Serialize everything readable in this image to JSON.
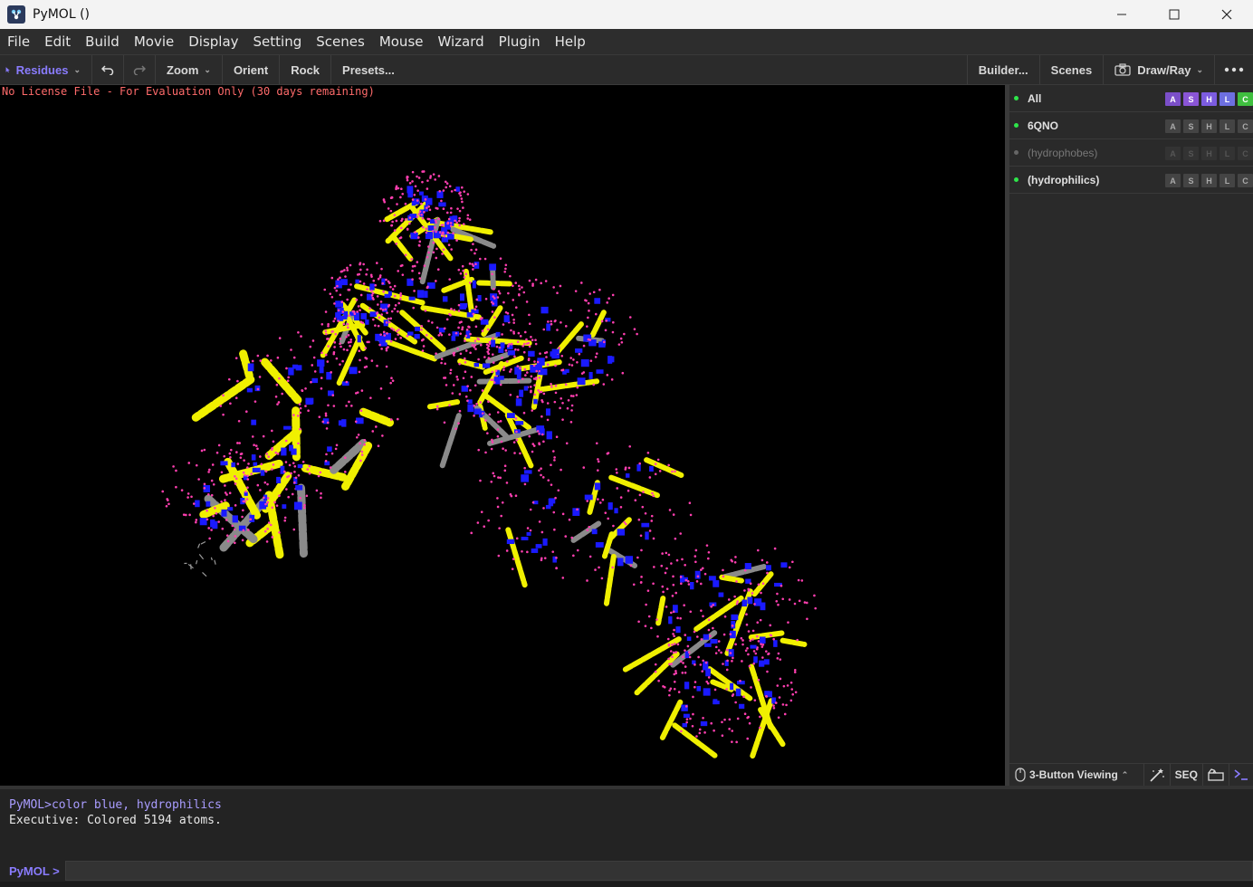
{
  "window": {
    "title": "PyMOL ()"
  },
  "menu": [
    "File",
    "Edit",
    "Build",
    "Movie",
    "Display",
    "Setting",
    "Scenes",
    "Mouse",
    "Wizard",
    "Plugin",
    "Help"
  ],
  "toolbar": {
    "selection_mode": "Residues",
    "zoom": "Zoom",
    "orient": "Orient",
    "rock": "Rock",
    "presets": "Presets...",
    "builder": "Builder...",
    "scenes": "Scenes",
    "draw_ray": "Draw/Ray"
  },
  "viewer": {
    "license_notice": "No License File - For Evaluation Only (30 days remaining)",
    "background": "#000000",
    "colors": {
      "cartoon_helix": "#f0f000",
      "hydrophilic_atoms": "#1a1aff",
      "dots": "#ff3fb0",
      "loops": "#8a8a8a"
    }
  },
  "objects": [
    {
      "name": "All",
      "enabled": true,
      "buttons": [
        "A",
        "S",
        "H",
        "L",
        "C"
      ]
    },
    {
      "name": "6QNO",
      "enabled": true,
      "buttons": [
        "A",
        "S",
        "H",
        "L",
        "C"
      ]
    },
    {
      "name": "(hydrophobes)",
      "enabled": false,
      "buttons": [
        "A",
        "S",
        "H",
        "L",
        "C"
      ]
    },
    {
      "name": "(hydrophilics)",
      "enabled": true,
      "buttons": [
        "A",
        "S",
        "H",
        "L",
        "C"
      ]
    }
  ],
  "panel_footer": {
    "mouse_mode": "3-Button Viewing",
    "seq": "SEQ"
  },
  "console": {
    "line1": "PyMOL>color blue, hydrophilics",
    "line2": " Executive: Colored 5194 atoms.",
    "prompt": "PyMOL >",
    "input": ""
  }
}
